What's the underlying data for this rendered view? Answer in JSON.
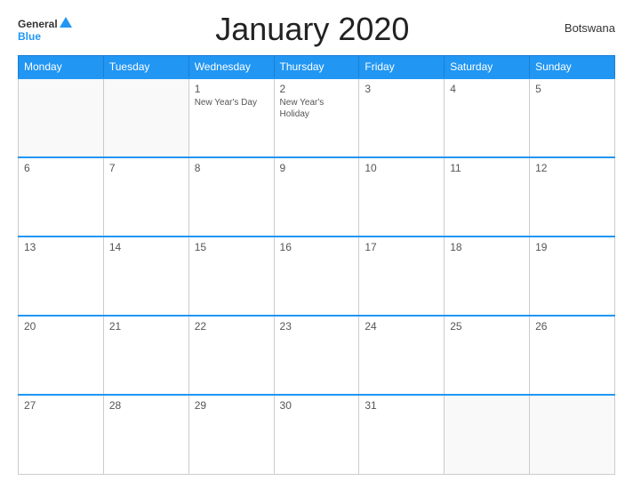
{
  "header": {
    "title": "January 2020",
    "country": "Botswana"
  },
  "logo": {
    "general": "General",
    "blue": "Blue"
  },
  "days": {
    "headers": [
      "Monday",
      "Tuesday",
      "Wednesday",
      "Thursday",
      "Friday",
      "Saturday",
      "Sunday"
    ]
  },
  "weeks": [
    [
      {
        "date": "",
        "holiday": ""
      },
      {
        "date": "",
        "holiday": ""
      },
      {
        "date": "1",
        "holiday": "New Year's Day"
      },
      {
        "date": "2",
        "holiday": "New Year's Holiday"
      },
      {
        "date": "3",
        "holiday": ""
      },
      {
        "date": "4",
        "holiday": ""
      },
      {
        "date": "5",
        "holiday": ""
      }
    ],
    [
      {
        "date": "6",
        "holiday": ""
      },
      {
        "date": "7",
        "holiday": ""
      },
      {
        "date": "8",
        "holiday": ""
      },
      {
        "date": "9",
        "holiday": ""
      },
      {
        "date": "10",
        "holiday": ""
      },
      {
        "date": "11",
        "holiday": ""
      },
      {
        "date": "12",
        "holiday": ""
      }
    ],
    [
      {
        "date": "13",
        "holiday": ""
      },
      {
        "date": "14",
        "holiday": ""
      },
      {
        "date": "15",
        "holiday": ""
      },
      {
        "date": "16",
        "holiday": ""
      },
      {
        "date": "17",
        "holiday": ""
      },
      {
        "date": "18",
        "holiday": ""
      },
      {
        "date": "19",
        "holiday": ""
      }
    ],
    [
      {
        "date": "20",
        "holiday": ""
      },
      {
        "date": "21",
        "holiday": ""
      },
      {
        "date": "22",
        "holiday": ""
      },
      {
        "date": "23",
        "holiday": ""
      },
      {
        "date": "24",
        "holiday": ""
      },
      {
        "date": "25",
        "holiday": ""
      },
      {
        "date": "26",
        "holiday": ""
      }
    ],
    [
      {
        "date": "27",
        "holiday": ""
      },
      {
        "date": "28",
        "holiday": ""
      },
      {
        "date": "29",
        "holiday": ""
      },
      {
        "date": "30",
        "holiday": ""
      },
      {
        "date": "31",
        "holiday": ""
      },
      {
        "date": "",
        "holiday": ""
      },
      {
        "date": "",
        "holiday": ""
      }
    ]
  ]
}
